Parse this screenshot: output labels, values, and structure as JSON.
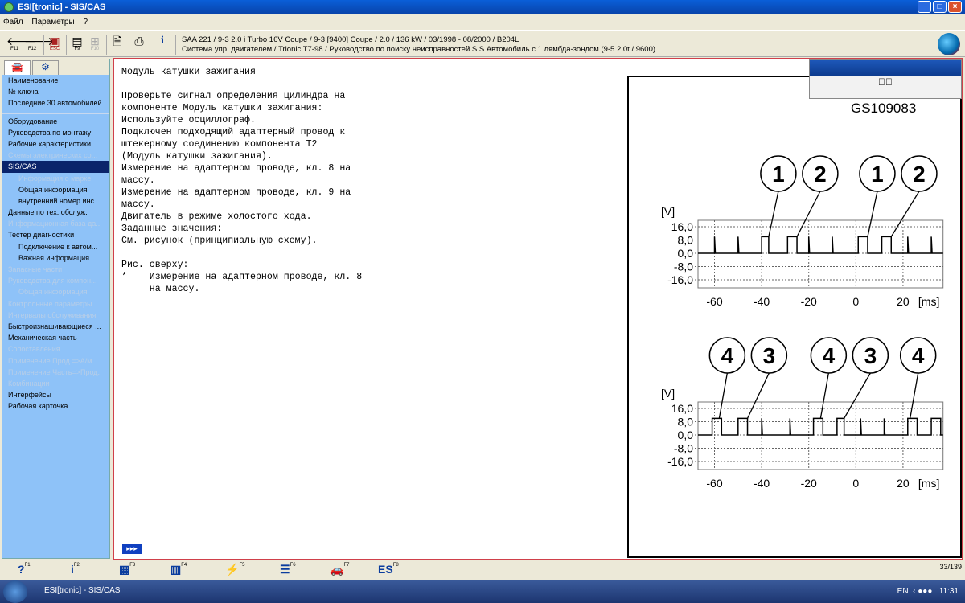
{
  "window": {
    "title": "ESI[tronic] - SIS/CAS"
  },
  "menu": [
    "Файл",
    "Параметры",
    "?"
  ],
  "toolbar": {
    "buttons": [
      {
        "icon": "arrow-left-icon",
        "key": "F11"
      },
      {
        "icon": "arrow-right-icon",
        "key": "F12"
      },
      {
        "icon": "exit-icon",
        "key": "ESC"
      },
      {
        "icon": "list-icon",
        "key": "F9"
      },
      {
        "icon": "tree-icon",
        "key": "F10"
      },
      {
        "icon": "document-icon",
        "key": ""
      },
      {
        "icon": "print-icon",
        "key": ""
      },
      {
        "icon": "info-icon",
        "key": ""
      }
    ],
    "vehicle_line1": "SAA 221 / 9-3 2.0 i Turbo 16V Coupe / 9-3 [9400] Coupe / 2.0 / 136 kW / 03/1998 - 08/2000 / B204L",
    "vehicle_line2": "Система упр. двигателем / Trionic T7-98 / Руководство по поиску неисправностей SIS Автомобиль с 1 лямбда-зондом  (9-5 2.0t  /  9600)"
  },
  "sidebar": {
    "top_items": [
      "Наименование",
      "№ ключа",
      "Последние 30 автомобилей"
    ],
    "items": [
      {
        "label": "Оборудование",
        "state": "normal"
      },
      {
        "label": "Руководства по монтажу",
        "state": "normal"
      },
      {
        "label": "Рабочие характеристики",
        "state": "normal"
      },
      {
        "label": "Схемы электрических со...",
        "state": "disabled"
      },
      {
        "label": "SIS/CAS",
        "state": "selected"
      },
      {
        "label": "Информация о марке",
        "state": "disabled",
        "indent": true
      },
      {
        "label": "Общая информация",
        "state": "normal",
        "indent": true
      },
      {
        "label": "внутренний номер инс...",
        "state": "normal",
        "indent": true
      },
      {
        "label": "Данные по тех. обслуж.",
        "state": "normal"
      },
      {
        "label": "Информационная база да...",
        "state": "disabled"
      },
      {
        "label": "Тестер диагностики",
        "state": "normal"
      },
      {
        "label": "Подключение к автом...",
        "state": "normal",
        "indent": true
      },
      {
        "label": "Важная информация",
        "state": "normal",
        "indent": true
      },
      {
        "label": "Запасные части",
        "state": "disabled"
      },
      {
        "label": "Руководства для компон...",
        "state": "disabled"
      },
      {
        "label": "Общая информация",
        "state": "disabled",
        "indent": true
      },
      {
        "label": "Контрольные параметры...",
        "state": "disabled"
      },
      {
        "label": "Интервалы обслуживания",
        "state": "disabled"
      },
      {
        "label": "Быстроизнашивающиеся ...",
        "state": "normal"
      },
      {
        "label": "Механическая часть",
        "state": "normal"
      },
      {
        "label": "Сопоставления",
        "state": "disabled"
      },
      {
        "label": "Применение Прод.=>А/м.",
        "state": "disabled"
      },
      {
        "label": "Применение Часть=>Прод.",
        "state": "disabled"
      },
      {
        "label": "Комбинации",
        "state": "disabled"
      },
      {
        "label": "Интерфейсы",
        "state": "normal"
      },
      {
        "label": "Рабочая карточка",
        "state": "normal"
      }
    ]
  },
  "content": {
    "text": "Модуль катушки зажигания\n\nПроверьте сигнал определения цилиндра на\nкомпоненте Модуль катушки зажигания:\nИспользуйте осциллограф.\nПодключен подходящий адаптерный провод к\nштекерному соединению компонента T2\n(Модуль катушки зажигания).\nИзмерение на адаптерном проводе, кл. 8 на\nмассу.\nИзмерение на адаптерном проводе, кл. 9 на\nмассу.\nДвигатель в режиме холостого хода.\nЗаданные значения:\nСм. рисунок (принципиальную схему).\n\nРис. сверху:\n*    Измерение на адаптерном проводе, кл. 8\n     на массу.",
    "more_label": "▸▸▸"
  },
  "figure": {
    "id": "GS109083",
    "ylabel": "[V]",
    "xunit": "[ms]",
    "yticks": [
      "16,0",
      "8,0",
      "0,0",
      "-8,0",
      "-16,0"
    ],
    "ytick_values": [
      16,
      8,
      0,
      -8,
      -16
    ],
    "xticks": [
      "-60",
      "-40",
      "-20",
      "0",
      "20"
    ],
    "xtick_values": [
      -60,
      -40,
      -20,
      0,
      20
    ],
    "plots": [
      {
        "pulses": [
          [
            -40,
            -37
          ],
          [
            -29,
            -25
          ],
          [
            1,
            5
          ],
          [
            11,
            15
          ]
        ],
        "spikes": [
          -60,
          -50,
          -20,
          -10,
          22,
          32
        ],
        "callouts": [
          {
            "label": "1",
            "target": -37
          },
          {
            "label": "2",
            "target": -25
          },
          {
            "label": "1",
            "target": 5
          },
          {
            "label": "2",
            "target": 15
          }
        ]
      },
      {
        "pulses": [
          [
            -61,
            -57
          ],
          [
            -50,
            -46
          ],
          [
            -18,
            -14
          ],
          [
            -8,
            -5
          ],
          [
            22,
            26
          ],
          [
            32,
            36
          ]
        ],
        "spikes": [
          -40,
          -28,
          2,
          12
        ],
        "callouts": [
          {
            "label": "4",
            "target": -58
          },
          {
            "label": "3",
            "target": -46
          },
          {
            "label": "4",
            "target": -15
          },
          {
            "label": "3",
            "target": -5
          },
          {
            "label": "4",
            "target": 23
          }
        ]
      }
    ]
  },
  "fkeys": [
    {
      "icon": "help-icon",
      "key": "F1",
      "glyph": "?"
    },
    {
      "icon": "info-icon",
      "key": "F2",
      "glyph": "i"
    },
    {
      "icon": "components-icon",
      "key": "F3",
      "glyph": "▦"
    },
    {
      "icon": "schematic-icon",
      "key": "F4",
      "glyph": "▥"
    },
    {
      "icon": "tester-icon",
      "key": "F5",
      "glyph": "⚡"
    },
    {
      "icon": "kts-list-icon",
      "key": "F6",
      "glyph": "☰"
    },
    {
      "icon": "car-icon",
      "key": "F7",
      "glyph": "🚗"
    },
    {
      "icon": "esi-kts-icon",
      "key": "F8",
      "glyph": "ES"
    }
  ],
  "page_count": "33/139",
  "taskbar": {
    "item": "ESI[tronic] - SIS/CAS",
    "lang": "EN",
    "clock": "11:31"
  }
}
